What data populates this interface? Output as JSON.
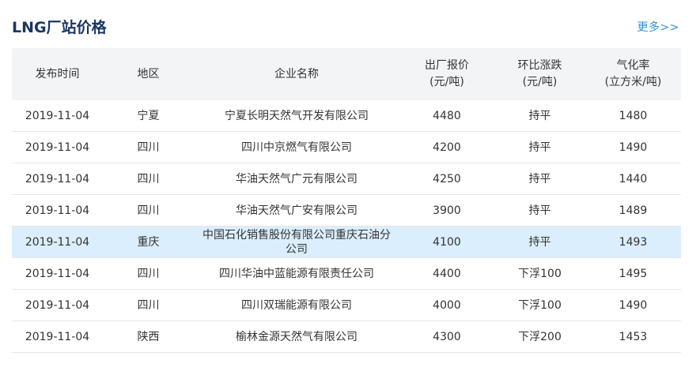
{
  "header": {
    "title": "LNG厂站价格",
    "more_label": "更多>>"
  },
  "table": {
    "columns": [
      {
        "line1": "发布时间",
        "line2": ""
      },
      {
        "line1": "地区",
        "line2": ""
      },
      {
        "line1": "企业名称",
        "line2": ""
      },
      {
        "line1": "出厂报价",
        "line2": "(元/吨)"
      },
      {
        "line1": "环比涨跌",
        "line2": "(元/吨)"
      },
      {
        "line1": "气化率",
        "line2": "(立方米/吨)"
      }
    ],
    "rows": [
      {
        "date": "2019-11-04",
        "region": "宁夏",
        "company": "宁夏长明天然气开发有限公司",
        "price": "4480",
        "change": "持平",
        "rate": "1480"
      },
      {
        "date": "2019-11-04",
        "region": "四川",
        "company": "四川中京燃气有限公司",
        "price": "4200",
        "change": "持平",
        "rate": "1490"
      },
      {
        "date": "2019-11-04",
        "region": "四川",
        "company": "华油天然气广元有限公司",
        "price": "4250",
        "change": "持平",
        "rate": "1440"
      },
      {
        "date": "2019-11-04",
        "region": "四川",
        "company": "华油天然气广安有限公司",
        "price": "3900",
        "change": "持平",
        "rate": "1489"
      },
      {
        "date": "2019-11-04",
        "region": "重庆",
        "company": "中国石化销售股份有限公司重庆石油分公司",
        "price": "4100",
        "change": "持平",
        "rate": "1493"
      },
      {
        "date": "2019-11-04",
        "region": "四川",
        "company": "四川华油中蓝能源有限责任公司",
        "price": "4400",
        "change": "下浮100",
        "rate": "1495"
      },
      {
        "date": "2019-11-04",
        "region": "四川",
        "company": "四川双瑞能源有限公司",
        "price": "4000",
        "change": "下浮100",
        "rate": "1490"
      },
      {
        "date": "2019-11-04",
        "region": "陕西",
        "company": "榆林金源天然气有限公司",
        "price": "4300",
        "change": "下浮200",
        "rate": "1453"
      }
    ]
  },
  "colors": {
    "title": "#1a3565",
    "link": "#2f8fdc",
    "header_bg": "#f2f4f6",
    "highlight_row": "#dbeefd"
  }
}
